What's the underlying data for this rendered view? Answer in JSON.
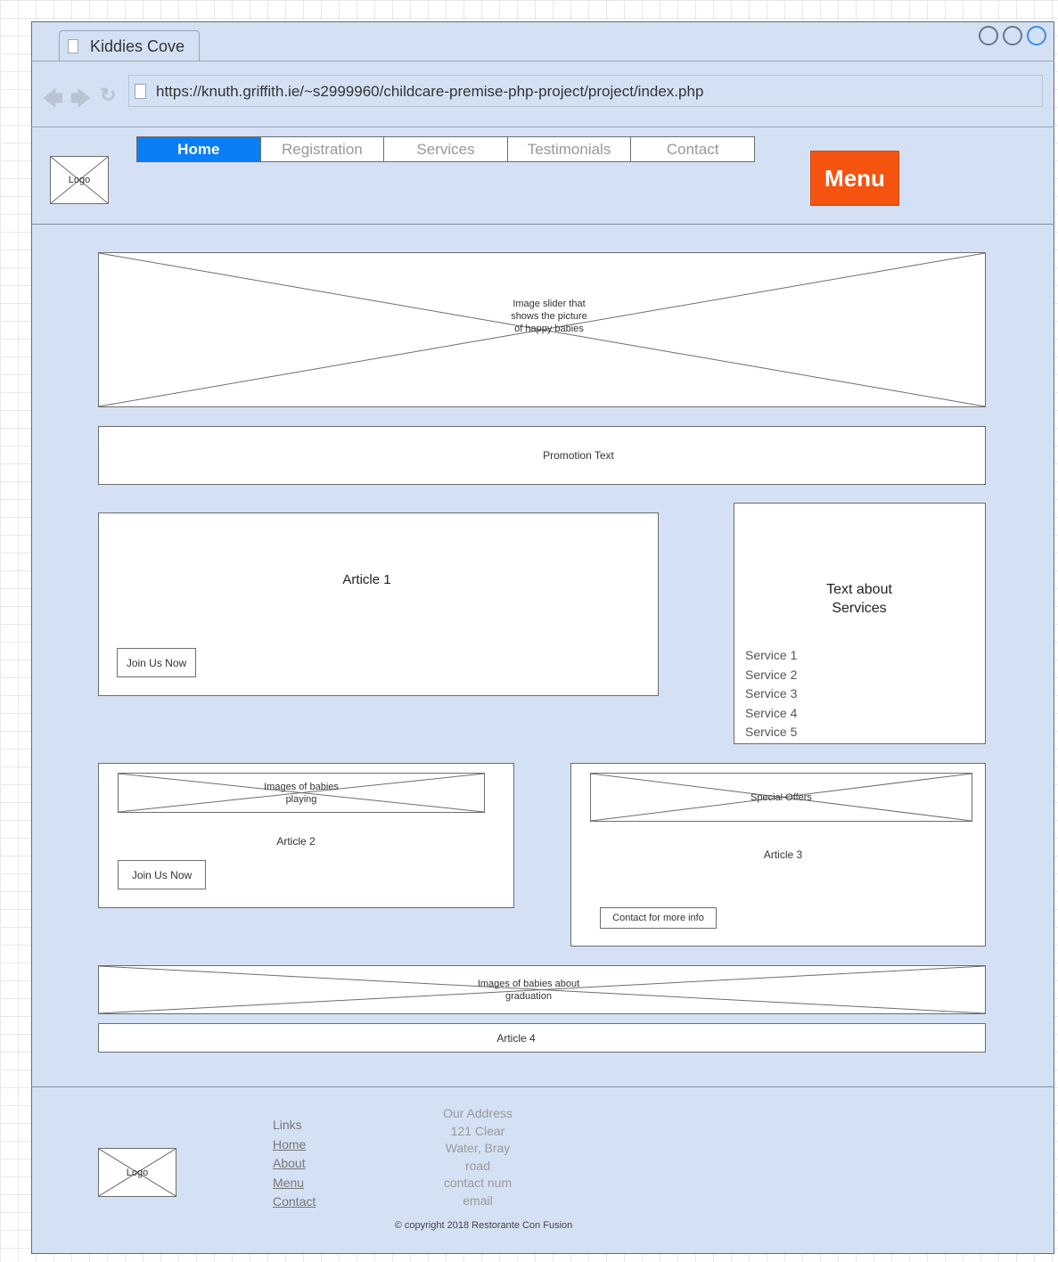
{
  "browser": {
    "tab_title": "Kiddies Cove",
    "url": "https://knuth.griffith.ie/~s2999960/childcare-premise-php-project/project/index.php"
  },
  "header": {
    "logo_label": "Logo",
    "nav": [
      {
        "label": "Home",
        "active": true
      },
      {
        "label": "Registration"
      },
      {
        "label": "Services"
      },
      {
        "label": "Testimonials"
      },
      {
        "label": "Contact"
      }
    ],
    "menu_button": "Menu",
    "menu_color": "#f4540f",
    "active_color": "#0a7ef5"
  },
  "main": {
    "slider": {
      "text": "Image slider that shows the picture of happy babies"
    },
    "promotion": {
      "text": "Promotion Text"
    },
    "article1": {
      "title": "Article 1",
      "button": "Join Us Now"
    },
    "services_panel": {
      "heading": "Text about Services",
      "items": [
        "Service 1",
        "Service 2",
        "Service 3",
        "Service 4",
        "Service 5"
      ]
    },
    "article2": {
      "image_text": "Images of babies playing",
      "title": "Article 2",
      "button": "Join Us Now"
    },
    "article3": {
      "image_text": "Special Offers",
      "title": "Article 3",
      "button": "Contact for more info"
    },
    "graduation": {
      "text": "Images of babies about graduation"
    },
    "article4": {
      "title": "Article 4"
    }
  },
  "footer": {
    "logo_label": "Logo",
    "links_heading": "Links",
    "links": [
      "Home",
      "About",
      "Menu",
      "Contact"
    ],
    "address_lines": [
      "Our Address",
      "121 Clear",
      "Water, Bray",
      "road",
      "contact num",
      "email"
    ],
    "copyright": "© copyright 2018 Restorante Con Fusion"
  }
}
